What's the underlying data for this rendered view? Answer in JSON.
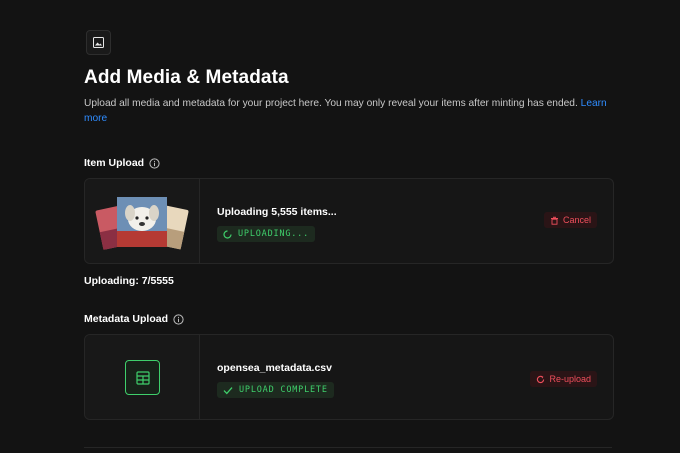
{
  "header": {
    "icon": "image-icon",
    "title": "Add Media & Metadata",
    "description": "Upload all media and metadata for your project here. You may only reveal your items after minting has ended.",
    "learn_more": "Learn more"
  },
  "item_upload": {
    "section_title": "Item Upload",
    "file_label": "Uploading 5,555 items...",
    "status_badge": "UPLOADING...",
    "action_label": "Cancel",
    "progress_text": "Uploading: 7/5555"
  },
  "metadata_upload": {
    "section_title": "Metadata Upload",
    "file_label": "opensea_metadata.csv",
    "status_badge": "UPLOAD COMPLETE",
    "action_label": "Re-upload"
  },
  "colors": {
    "background": "#131313",
    "card": "#161616",
    "accent_blue": "#2f8cff",
    "success_green": "#3fcf6b",
    "danger_red": "#ef4f5c"
  }
}
